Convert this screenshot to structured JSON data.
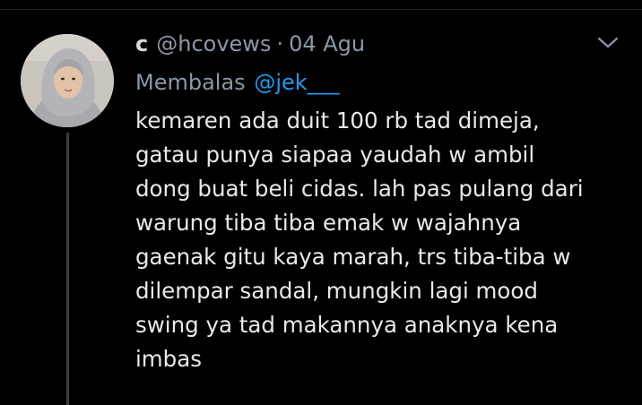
{
  "tweet": {
    "display_name": "c",
    "handle": "@hcovews",
    "separator": "·",
    "date": "04 Agu",
    "replying_prefix": "Membalas",
    "replying_to": "@jek___",
    "text_lines": [
      "kemaren ada duit 100 rb tad dimeja,",
      "gatau punya siapaa yaudah w ambil",
      "dong buat beli cidas. lah pas pulang dari",
      "warung tiba tiba emak w wajahnya",
      "gaenak gitu kaya marah, trs tiba-tiba w",
      "dilempar sandal, mungkin lagi mood",
      "swing ya tad makannya anaknya kena",
      "imbas"
    ]
  },
  "icons": {
    "more": "chevron-down-icon",
    "avatar": "profile-photo"
  },
  "colors": {
    "background": "#000000",
    "primary_text": "#e7e9ea",
    "secondary_text": "#8b98a5",
    "accent": "#1d9bf0"
  }
}
